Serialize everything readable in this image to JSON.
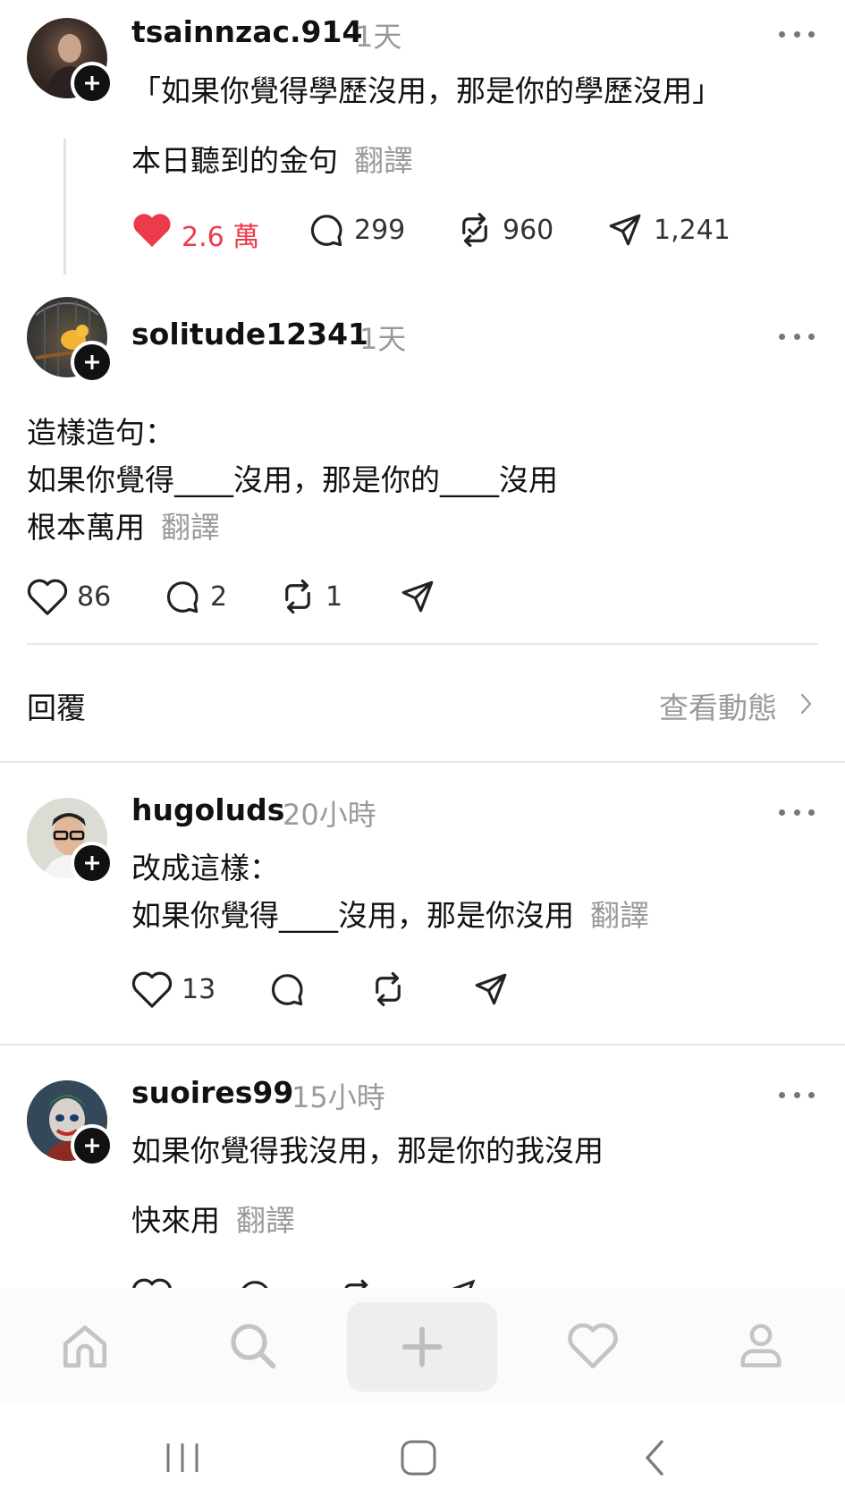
{
  "posts": [
    {
      "username": "tsainnzac.914",
      "time": "1天",
      "lines": [
        "「如果你覺得學歷沒用，那是你的學歷沒用」",
        "本日聽到的金句"
      ],
      "translate": "翻譯",
      "likes": "2.6 萬",
      "comments": "299",
      "reposts": "960",
      "shares": "1,241",
      "liked": true
    },
    {
      "username": "solitude12341",
      "time": "1天",
      "lines": [
        "造樣造句：",
        "如果你覺得____沒用，那是你的____沒用",
        "根本萬用"
      ],
      "translate": "翻譯",
      "likes": "86",
      "comments": "2",
      "reposts": "1"
    },
    {
      "username": "hugoluds",
      "time": "20小時",
      "lines": [
        "改成這樣：",
        "如果你覺得____沒用，那是你沒用"
      ],
      "translate": "翻譯",
      "likes": "13"
    },
    {
      "username": "suoires99",
      "time": "15小時",
      "lines": [
        "如果你覺得我沒用，那是你的我沒用",
        "快來用"
      ],
      "translate": "翻譯"
    }
  ],
  "reply_bar": {
    "reply": "回覆",
    "view_activity": "查看動態"
  },
  "colors": {
    "like_red": "#ec3b4b",
    "muted": "#9a9a9a",
    "text": "#111111"
  },
  "nav": [
    "home-icon",
    "search-icon",
    "plus-icon",
    "heart-icon",
    "profile-icon"
  ],
  "system_nav": [
    "recents-icon",
    "home-square-icon",
    "back-icon"
  ]
}
